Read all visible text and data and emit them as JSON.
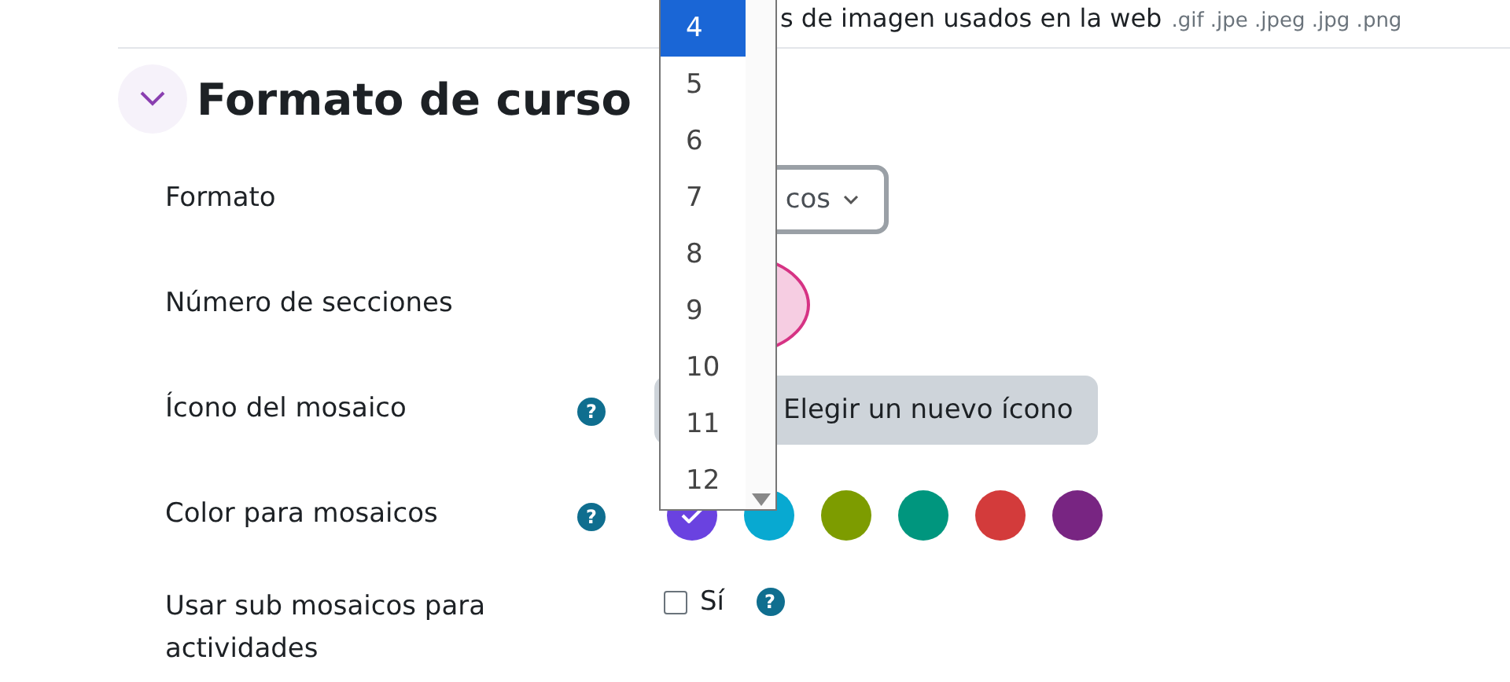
{
  "top_note": {
    "text": "s de imagen usados en la web",
    "extensions": ".gif .jpe .jpeg .jpg .png"
  },
  "section": {
    "title": "Formato de curso",
    "expanded": true
  },
  "fields": [
    {
      "kind": "select",
      "label": "Formato",
      "value": "cos"
    },
    {
      "kind": "circle",
      "label": "Número de secciones"
    },
    {
      "kind": "button",
      "label": "Ícono del mosaico",
      "button": "Elegir un nuevo ícono",
      "help": "?"
    },
    {
      "kind": "colors",
      "label": "Color para mosaicos",
      "help": "?",
      "colors": [
        {
          "color": "#6a42e0",
          "selected": true
        },
        {
          "color": "#08a9d1",
          "selected": false
        },
        {
          "color": "#7d9c00",
          "selected": false
        },
        {
          "color": "#00967e",
          "selected": false
        },
        {
          "color": "#d33b3b",
          "selected": false
        },
        {
          "color": "#782582",
          "selected": false
        }
      ]
    },
    {
      "kind": "checkbox",
      "label": "Usar sub mosaicos para actividades",
      "option": "Sí",
      "checked": false,
      "option_help": "?"
    }
  ],
  "dropdown": {
    "options": [
      {
        "label": "4",
        "selected": true
      },
      {
        "label": "5",
        "selected": false
      },
      {
        "label": "6",
        "selected": false
      },
      {
        "label": "7",
        "selected": false
      },
      {
        "label": "8",
        "selected": false
      },
      {
        "label": "9",
        "selected": false
      },
      {
        "label": "10",
        "selected": false
      },
      {
        "label": "11",
        "selected": false
      },
      {
        "label": "12",
        "selected": false
      }
    ]
  }
}
